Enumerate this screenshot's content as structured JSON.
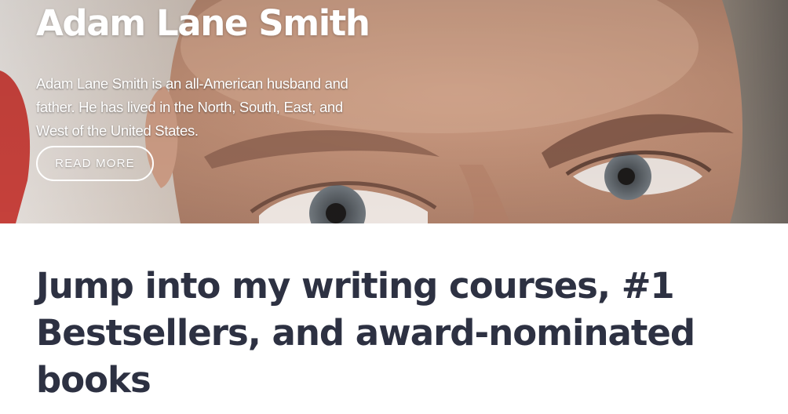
{
  "hero": {
    "title": "Adam Lane Smith",
    "bio": "Adam Lane Smith is an all-American husband and father. He has lived in the North, South, East, and West of the United States.",
    "read_more_label": "READ MORE",
    "background_image": "close-up photo of a man's eyes and face"
  },
  "main": {
    "headline": "Jump into my writing courses, #1 Bestsellers, and award-nominated books"
  },
  "colors": {
    "headline": "#2d3142",
    "hero_text": "#ffffff",
    "button_border": "#ffffff"
  }
}
